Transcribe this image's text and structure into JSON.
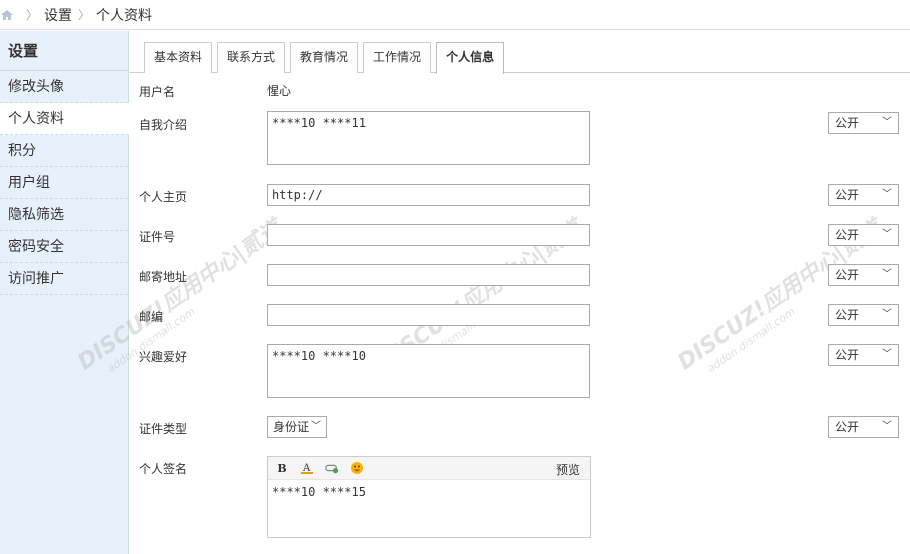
{
  "breadcrumb": {
    "items": [
      "设置",
      "个人资料"
    ]
  },
  "sidebar": {
    "title": "设置",
    "items": [
      {
        "label": "修改头像"
      },
      {
        "label": "个人资料"
      },
      {
        "label": "积分"
      },
      {
        "label": "用户组"
      },
      {
        "label": "隐私筛选"
      },
      {
        "label": "密码安全"
      },
      {
        "label": "访问推广"
      }
    ]
  },
  "tabs": [
    {
      "label": "基本资料"
    },
    {
      "label": "联系方式"
    },
    {
      "label": "教育情况"
    },
    {
      "label": "工作情况"
    },
    {
      "label": "个人信息"
    }
  ],
  "form": {
    "username_label": "用户名",
    "username_value": "惺心",
    "bio_label": "自我介绍",
    "bio_value": "****10 ****11",
    "homepage_label": "个人主页",
    "homepage_value": "http://",
    "idnumber_label": "证件号",
    "idnumber_value": "",
    "address_label": "邮寄地址",
    "address_value": "",
    "zipcode_label": "邮编",
    "zipcode_value": "",
    "hobby_label": "兴趣爱好",
    "hobby_value": "****10 ****10",
    "idtype_label": "证件类型",
    "idtype_value": "身份证",
    "signature_label": "个人签名",
    "signature_value": "****10 ****15",
    "preview_label": "预览"
  },
  "privacy": {
    "value": "公开"
  },
  "watermark": {
    "text": "DISCUZ!应用中心|贰道",
    "sub": "addon.dismall.com"
  },
  "colors": {
    "sidebar_bg": "#e8f1fb",
    "border": "#aaaaaa"
  }
}
